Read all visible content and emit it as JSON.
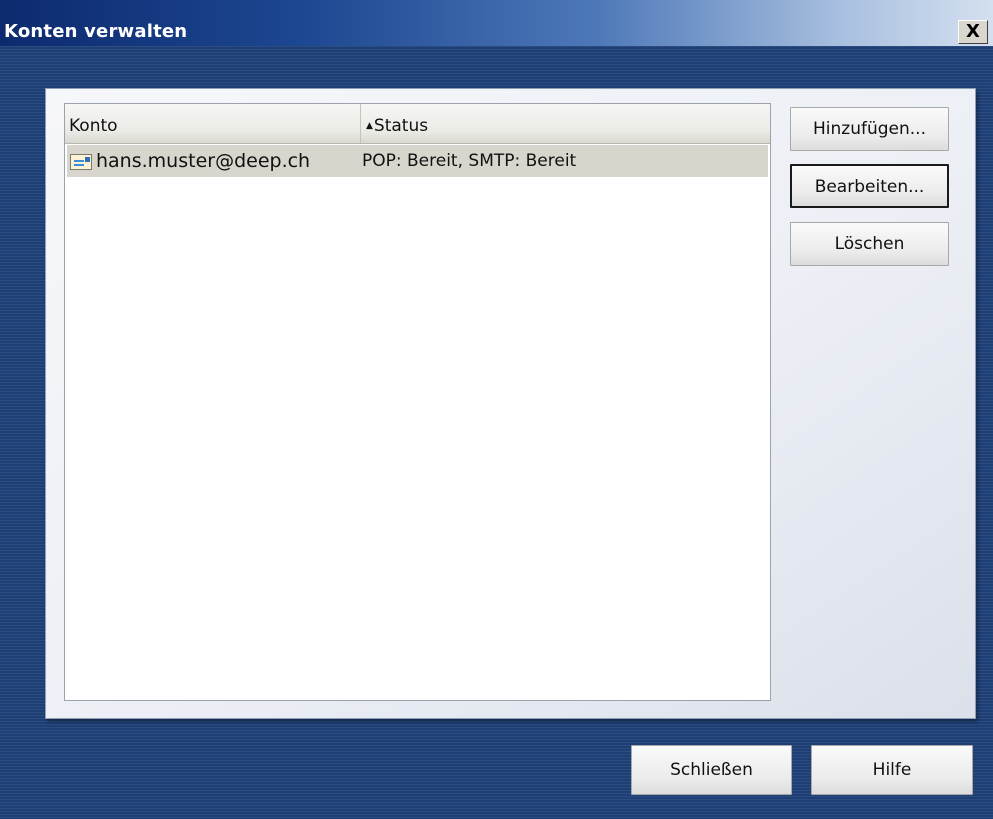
{
  "window": {
    "title": "Konten verwalten",
    "close_label": "X"
  },
  "list": {
    "columns": [
      {
        "label": "Konto"
      },
      {
        "label": "Status",
        "sort_indicator": "▲",
        "sorted": "ascending"
      }
    ],
    "rows": [
      {
        "icon": "mail-account-icon",
        "konto": "hans.muster@deep.ch",
        "status": "POP: Bereit, SMTP: Bereit",
        "selected": true
      }
    ]
  },
  "side_buttons": {
    "add": "Hinzufügen...",
    "edit": "Bearbeiten...",
    "delete": "Löschen"
  },
  "bottom_buttons": {
    "close": "Schließen",
    "help": "Hilfe"
  },
  "colors": {
    "titlebar_start": "#0d2a6e",
    "titlebar_end": "#d4e0ef",
    "dialog_background": "#1d3f76",
    "selected_row": "#d8d5cd"
  }
}
